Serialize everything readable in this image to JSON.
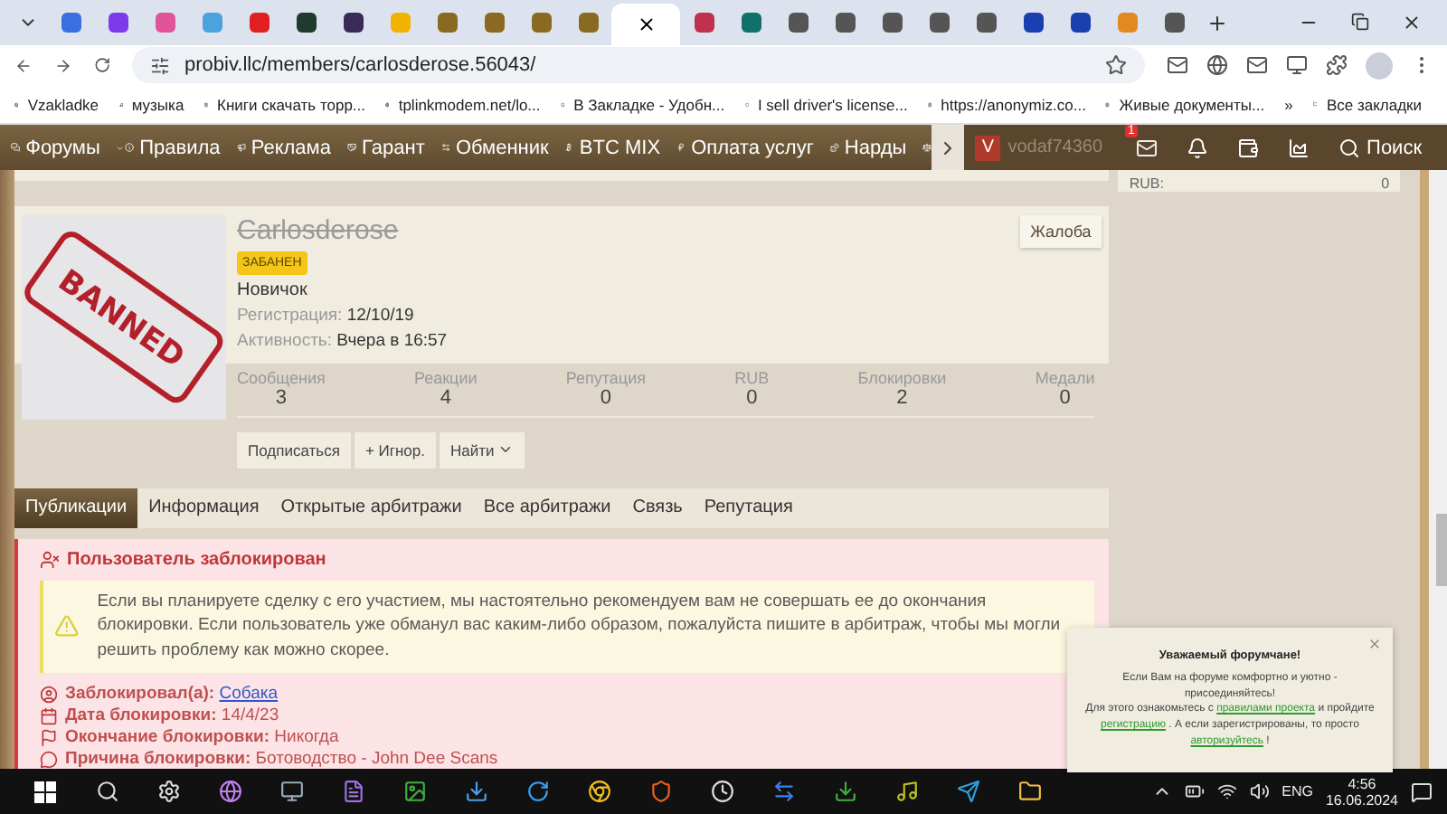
{
  "browser": {
    "tabs": [
      {
        "selected": false
      },
      {
        "selected": false
      },
      {
        "selected": false
      },
      {
        "selected": false
      },
      {
        "selected": false
      },
      {
        "selected": false
      },
      {
        "selected": false
      },
      {
        "selected": false
      },
      {
        "selected": false
      },
      {
        "selected": false
      },
      {
        "selected": false
      },
      {
        "selected": false
      },
      {
        "selected": true
      },
      {
        "selected": false
      },
      {
        "selected": false
      },
      {
        "selected": false
      },
      {
        "selected": false
      },
      {
        "selected": false
      },
      {
        "selected": false
      },
      {
        "selected": false
      },
      {
        "selected": false
      },
      {
        "selected": false
      },
      {
        "selected": false
      },
      {
        "selected": false
      }
    ],
    "url": "probiv.llc/members/carlosderose.56043/",
    "bookmarks": [
      "Vzakladke",
      "музыка",
      "Книги скачать торр...",
      "tplinkmodem.net/lo...",
      "В Закладке - Удобн...",
      "I sell driver's license...",
      "https://anonymiz.co...",
      "Живые документы..."
    ],
    "bookmarks_more": "»",
    "all_bookmarks": "Все закладки"
  },
  "nav": {
    "items": [
      {
        "label": "Форумы",
        "kind": "forums"
      },
      {
        "label": "Правила",
        "kind": "rules"
      },
      {
        "label": "Реклама",
        "kind": "ads"
      },
      {
        "label": "Гарант",
        "kind": "guarantee"
      },
      {
        "label": "Обменник",
        "kind": "exchange"
      },
      {
        "label": "BTC MIX",
        "kind": "btc"
      },
      {
        "label": "Оплата услуг",
        "kind": "payment"
      },
      {
        "label": "Нарды",
        "kind": "dice"
      }
    ],
    "avatar_letter": "V",
    "username": "vodaf74360",
    "mail_badge": "1",
    "search": "Поиск"
  },
  "sidebar": {
    "label": "RUB:",
    "value": "0"
  },
  "profile": {
    "avatar_stamp": "BANNED",
    "name": "Carlosderose",
    "badge": "ЗАБАНЕН",
    "title": "Новичок",
    "facts": [
      {
        "label": "Регистрация:",
        "value": "12/10/19"
      },
      {
        "label": "Активность:",
        "value": "Вчера в 16:57"
      }
    ],
    "report": "Жалоба",
    "stats": [
      {
        "label": "Сообщения",
        "value": "3"
      },
      {
        "label": "Реакции",
        "value": "4"
      },
      {
        "label": "Репутация",
        "value": "0"
      },
      {
        "label": "RUB",
        "value": "0"
      },
      {
        "label": "Блокировки",
        "value": "2"
      },
      {
        "label": "Медали",
        "value": "0"
      }
    ],
    "actions": [
      {
        "label": "Подписаться",
        "kind": "plain"
      },
      {
        "label": "+ Игнор.",
        "kind": "plain"
      },
      {
        "label": "Найти",
        "kind": "menu"
      }
    ]
  },
  "tabs": [
    {
      "label": "Публикации",
      "selected": true
    },
    {
      "label": "Информация",
      "selected": false
    },
    {
      "label": "Открытые арбитражи",
      "selected": false
    },
    {
      "label": "Все арбитражи",
      "selected": false
    },
    {
      "label": "Связь",
      "selected": false
    },
    {
      "label": "Репутация",
      "selected": false
    }
  ],
  "ban": {
    "title": "Пользователь заблокирован",
    "warning": "Если вы планируете сделку с его участием, мы настоятельно рекомендуем вам не совершать ее до окончания блокировки. Если пользователь уже обманул вас каким-либо образом, пожалуйста пишите в арбитраж, чтобы мы могли решить проблему как можно скорее.",
    "details": [
      {
        "kind": "user",
        "label": "Заблокировал(а):",
        "value": "Собака",
        "link": true
      },
      {
        "kind": "calendar",
        "label": "Дата блокировки:",
        "value": "14/4/23",
        "link": false
      },
      {
        "kind": "flag",
        "label": "Окончание блокировки:",
        "value": "Никогда",
        "link": false
      },
      {
        "kind": "comment",
        "label": "Причина блокировки:",
        "value": "Ботоводство - John Dee Scans",
        "link": false
      }
    ]
  },
  "popup": {
    "title": "Уважаемый форумчане!",
    "text": "Если Вам на форуме комфортно и уютно - присоединяйтесь!",
    "parts": [
      {
        "kind": "text",
        "text": "Для этого ознакомьтесь с"
      },
      {
        "kind": "link",
        "text": "правилами проекта"
      },
      {
        "kind": "text",
        "text": "и пройдите"
      },
      {
        "kind": "link",
        "text": "регистрацию"
      },
      {
        "kind": "text",
        "text": ". А если зарегистрированы, то просто"
      },
      {
        "kind": "link",
        "text": "авторизуйтесь"
      },
      {
        "kind": "text",
        "text": "!"
      }
    ]
  },
  "taskbar": {
    "language": "ENG",
    "time": "4:56",
    "date": "16.06.2024"
  }
}
